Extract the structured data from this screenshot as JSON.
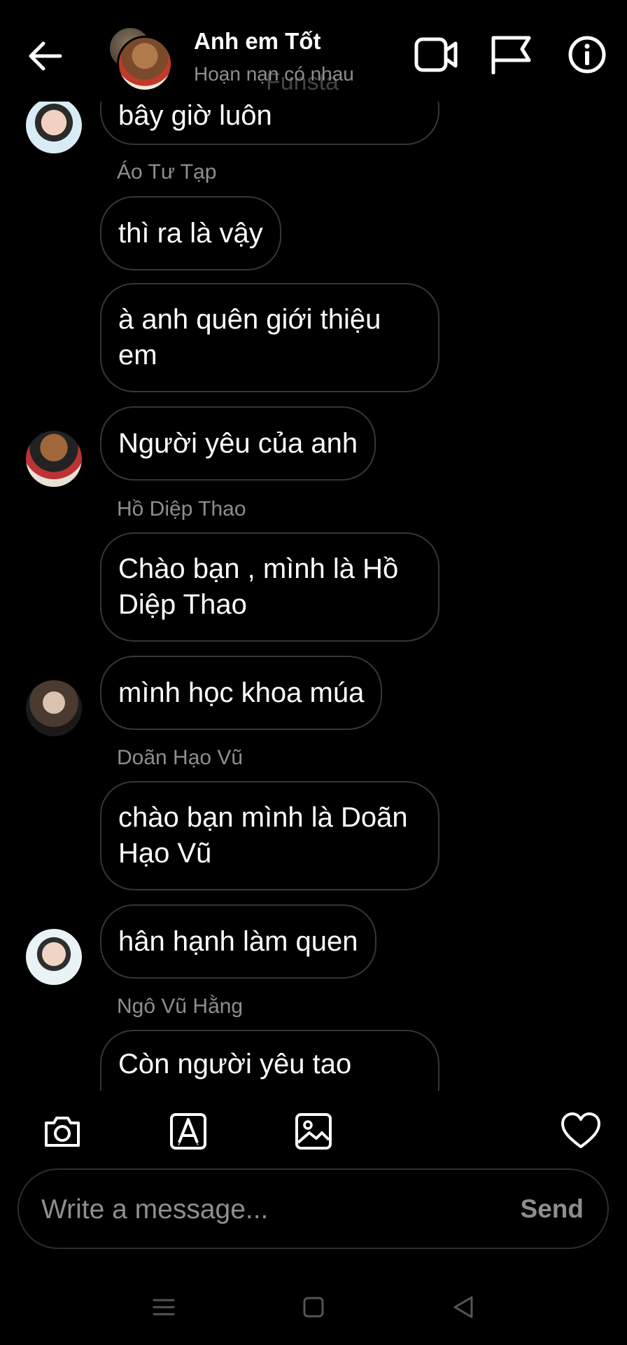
{
  "header": {
    "title": "Anh em Tốt",
    "subtitle": "Hoạn nạn có nhau",
    "ghost_text": "Funsta",
    "icons": [
      "arrow-left-icon",
      "video-call-icon",
      "flag-icon",
      "info-icon"
    ]
  },
  "messages": [
    {
      "type": "bubble",
      "text": "bây giờ luôn"
    },
    {
      "type": "sender",
      "text": "Áo Tư Tạp"
    },
    {
      "type": "bubble",
      "text": "thì ra là vậy"
    },
    {
      "type": "bubble",
      "text": "à anh quên giới thiệu em"
    },
    {
      "type": "bubble",
      "text": "Người yêu của anh"
    },
    {
      "type": "sender",
      "text": "Hồ Diệp Thao"
    },
    {
      "type": "bubble",
      "text": "Chào bạn , mình là Hồ Diệp Thao"
    },
    {
      "type": "bubble",
      "text": "mình học khoa múa"
    },
    {
      "type": "sender",
      "text": "Doãn Hạo Vũ"
    },
    {
      "type": "bubble",
      "text": "chào bạn mình là Doãn Hạo Vũ"
    },
    {
      "type": "bubble",
      "text": "hân hạnh làm quen"
    },
    {
      "type": "sender",
      "text": "Ngô Vũ Hằng"
    },
    {
      "type": "bubble",
      "text": "Còn người yêu tao"
    }
  ],
  "toolbar": {
    "icons": [
      "camera-icon",
      "text-style-icon",
      "gallery-icon",
      "heart-icon"
    ]
  },
  "composer": {
    "placeholder": "Write a message...",
    "send_label": "Send"
  },
  "navbar": {
    "icons": [
      "menu-icon",
      "home-icon",
      "back-triangle-icon"
    ]
  }
}
